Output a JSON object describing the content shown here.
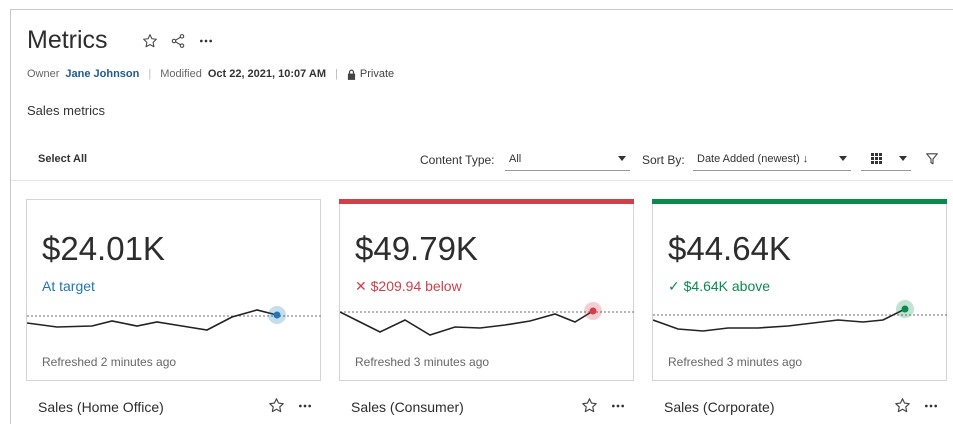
{
  "header": {
    "title": "Metrics",
    "owner_label": "Owner",
    "owner_name": "Jane Johnson",
    "modified_label": "Modified",
    "modified_value": "Oct 22, 2021, 10:07 AM",
    "privacy": "Private",
    "description": "Sales metrics"
  },
  "toolbar": {
    "select_all": "Select All",
    "content_type_label": "Content Type:",
    "content_type_value": "All",
    "sort_by_label": "Sort By:",
    "sort_by_value": "Date Added (newest) ↓"
  },
  "colors": {
    "accent_blue": "#1f77b4",
    "accent_red": "#d13f4a",
    "accent_green": "#0b8a4d"
  },
  "cards": [
    {
      "value": "$24.01K",
      "status": "At target",
      "status_type": "neutral",
      "refreshed": "Refreshed 2 minutes ago",
      "name": "Sales (Home Office)",
      "accent": "none"
    },
    {
      "value": "$49.79K",
      "status": "✕ $209.94 below",
      "status_type": "below",
      "refreshed": "Refreshed 3 minutes ago",
      "name": "Sales (Consumer)",
      "accent": "red"
    },
    {
      "value": "$44.64K",
      "status": "✓ $4.64K above",
      "status_type": "above",
      "refreshed": "Refreshed 3 minutes ago",
      "name": "Sales (Corporate)",
      "accent": "green"
    }
  ]
}
